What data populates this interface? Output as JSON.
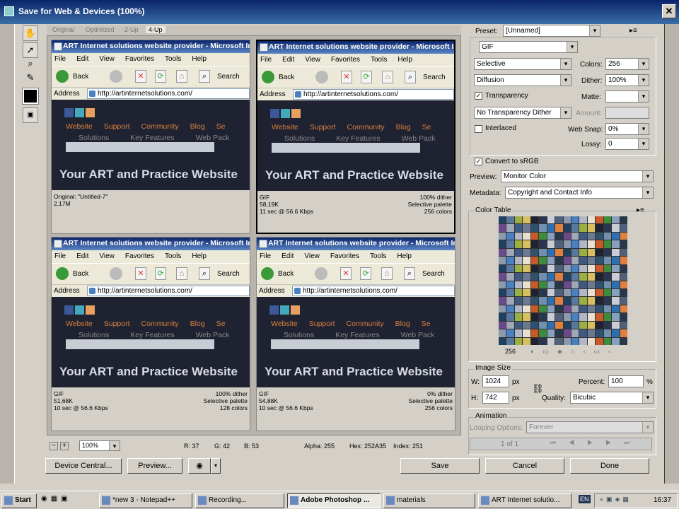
{
  "window": {
    "title": "Save for Web & Devices (100%)",
    "close_symbol": "✕"
  },
  "tools": [
    "hand-tool-icon",
    "slice-select-tool-icon",
    "zoom-tool-icon",
    "eyedropper-tool-icon"
  ],
  "view_tabs": [
    {
      "label": "Original",
      "selected": false
    },
    {
      "label": "Optimized",
      "selected": false
    },
    {
      "label": "2-Up",
      "selected": false
    },
    {
      "label": "4-Up",
      "selected": true
    }
  ],
  "browser": {
    "title": "ART Internet solutions website provider - Microsoft Internet Explorer",
    "menu": [
      "File",
      "Edit",
      "View",
      "Favorites",
      "Tools",
      "Help"
    ],
    "back": "Back",
    "search": "Search",
    "address_label": "Address",
    "url": "http://artinternetsolutions.com/",
    "nav": [
      "Website",
      "Support",
      "Community",
      "Blog",
      "Se"
    ],
    "subnav": [
      "Solutions",
      "Key Features",
      "Web Pack"
    ],
    "hero": "Your ART and Practice Website"
  },
  "panes": [
    {
      "l1": "Original: \"Untitled-7\"",
      "l2": "2,17M",
      "l3": "",
      "r1": "",
      "r2": "",
      "r3": ""
    },
    {
      "l1": "GIF",
      "l2": "58,19K",
      "l3": "11 sec @ 56.6 Kbps",
      "r1": "100% dither",
      "r2": "Selective palette",
      "r3": "256 colors"
    },
    {
      "l1": "GIF",
      "l2": "51,68K",
      "l3": "10 sec @ 56.6 Kbps",
      "r1": "100% dither",
      "r2": "Selective palette",
      "r3": "128 colors"
    },
    {
      "l1": "GIF",
      "l2": "54,88K",
      "l3": "10 sec @ 56.6 Kbps",
      "r1": "0% dither",
      "r2": "Selective palette",
      "r3": "256 colors"
    }
  ],
  "status": {
    "zoom": "100%",
    "r": "R: 37",
    "g": "G: 42",
    "b": "B: 53",
    "alpha": "Alpha: 255",
    "hex": "Hex: 252A35",
    "index": "Index: 251"
  },
  "settings": {
    "preset_label": "Preset:",
    "preset": "[Unnamed]",
    "format": "GIF",
    "palette": "Selective",
    "dither_algo": "Diffusion",
    "colors_label": "Colors:",
    "colors": "256",
    "dither_label": "Dither:",
    "dither": "100%",
    "transparency": "Transparency",
    "matte_label": "Matte:",
    "trans_dither": "No Transparency Dither",
    "amount_label": "Amount:",
    "interlaced": "Interlaced",
    "websnap_label": "Web Snap:",
    "websnap": "0%",
    "lossy_label": "Lossy:",
    "lossy": "0",
    "convert_srgb": "Convert to sRGB",
    "preview_label": "Preview:",
    "preview": "Monitor Color",
    "metadata_label": "Metadata:",
    "metadata": "Copyright and Contact Info"
  },
  "color_table": {
    "label": "Color Table",
    "count": "256"
  },
  "image_size": {
    "label": "Image Size",
    "w_label": "W:",
    "w": "1024",
    "h_label": "H:",
    "h": "742",
    "unit": "px",
    "percent_label": "Percent:",
    "percent": "100",
    "pct": "%",
    "quality_label": "Quality:",
    "quality": "Bicubic"
  },
  "animation": {
    "label": "Animation",
    "looping_label": "Looping Options:",
    "looping": "Forever",
    "frame": "1 of 1"
  },
  "buttons": {
    "device_central": "Device Central...",
    "preview": "Preview...",
    "save": "Save",
    "cancel": "Cancel",
    "done": "Done"
  },
  "taskbar": {
    "start": "Start",
    "items": [
      {
        "label": "*new 3 - Notepad++",
        "active": false
      },
      {
        "label": "Recording...",
        "active": false
      },
      {
        "label": "Adobe Photoshop ...",
        "active": true
      },
      {
        "label": "materials",
        "active": false
      },
      {
        "label": "ART Internet solutio...",
        "active": false
      }
    ],
    "lang": "EN",
    "clock": "16:37"
  },
  "colors": {
    "title_bar": "#0a246a",
    "hero_bg": "#1f2230",
    "nav_text": "#d88040"
  }
}
